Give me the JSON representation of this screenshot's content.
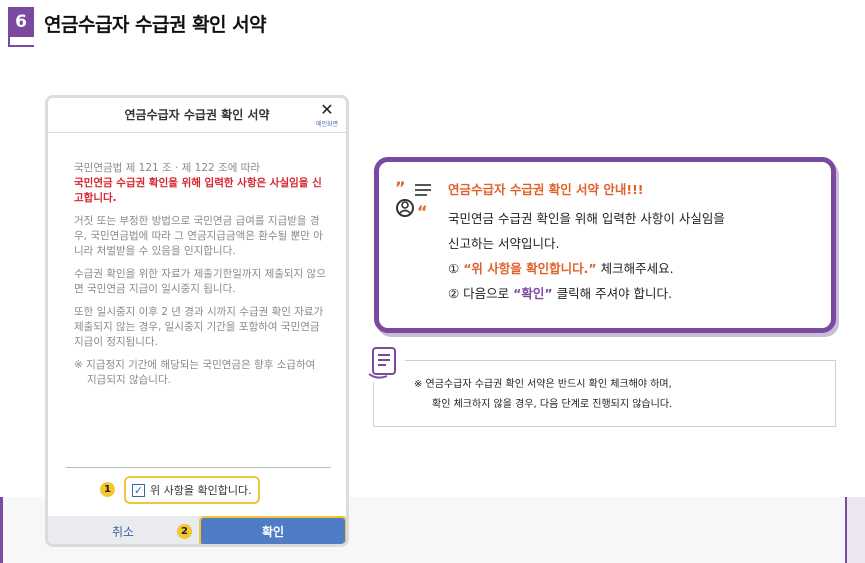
{
  "header": {
    "step_number": "6",
    "title": "연금수급자 수급권 확인 서약"
  },
  "dialog": {
    "title": "연금수급자 수급권 확인 서약",
    "close_icon": "close-icon",
    "close_label": "메인화면",
    "terms": {
      "p1_line": "국민연금법 제 121 조 · 제 122 조에 따라",
      "p1_red": "국민연금 수급권 확인을 위해 입력한 사항은 사실임을 신고합니다.",
      "p2": "거짓 또는 부정한 방법으로 국민연금 급여를 지급받을 경우, 국민연금법에 따라 그 연금지급금액은 환수될 뿐만 아니라 처벌받을 수 있음을 인지합니다.",
      "p3": "수급권 확인을 위한 자료가 제출기한일까지 제출되지 않으면 국민연금 지급이 일시중지 됩니다.",
      "p4": "또한 일시중지 이후 2 년 경과 시까지 수급권 확인 자료가 제출되지 않는 경우, 일시중지 기간을 포함하여 국민연금 지급이 정지됩니다.",
      "p5": "※ 지급정지 기간에 해당되는 국민연금은 향후 소급하여 지급되지 않습니다."
    },
    "badge1": "1",
    "badge2": "2",
    "checkbox_label": "위 사항을 확인합니다.",
    "checkbox_checked": true,
    "cancel_label": "취소",
    "confirm_label": "확인"
  },
  "callout": {
    "title": "연금수급자 수급권 확인 서약 안내!!!",
    "line1": "국민연금 수급권 확인을 위해 입력한 사항이 사실임을",
    "line2": "신고하는 서약입니다.",
    "line3_prefix": "①",
    "line3_highlight": "“위 사항을 확인합니다.”",
    "line3_suffix": "체크해주세요.",
    "line4_prefix": "② 다음으로",
    "line4_highlight": "“확인”",
    "line4_suffix": "클릭해 주셔야 합니다."
  },
  "note": {
    "line1": "※ 연금수급자 수급권 확인 서약은 반드시 확인 체크해야 하며,",
    "line2": "확인 체크하지 않을 경우, 다음 단계로 진행되지 않습니다."
  },
  "colors": {
    "accent": "#7b4aa0",
    "highlight": "#e0622a",
    "alert_red": "#d6262e",
    "badge": "#f3c72f",
    "confirm": "#4f7cc4"
  }
}
